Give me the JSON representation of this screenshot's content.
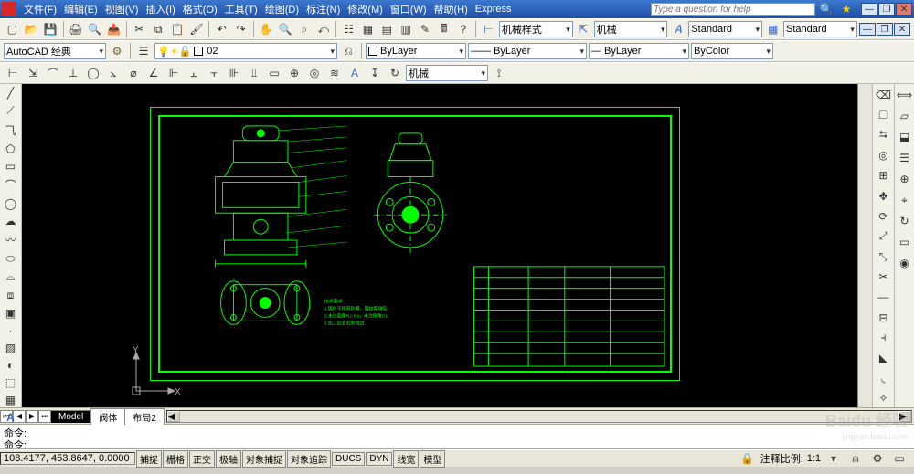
{
  "menu": {
    "file": "文件(F)",
    "edit": "编辑(E)",
    "view": "视图(V)",
    "insert": "插入(I)",
    "format": "格式(O)",
    "tools": "工具(T)",
    "draw": "绘图(D)",
    "dim": "标注(N)",
    "modify": "修改(M)",
    "window": "窗口(W)",
    "help": "帮助(H)",
    "express": "Express"
  },
  "help_placeholder": "Type a question for help",
  "workspace_combo": "AutoCAD 经典",
  "layer_combo": "02",
  "dimstyle1": "机械样式",
  "dimstyle2": "机械",
  "bylayer": "ByLayer",
  "bycolor": "ByColor",
  "standard": "Standard",
  "mech": "机械",
  "ucs": {
    "x": "X",
    "y": "Y"
  },
  "tabs": {
    "model": "Model",
    "layout1": "阀体",
    "layout2": "布局2"
  },
  "cmd_label": "命令:",
  "status": {
    "coords": "108.4177, 453.8647, 0.0000",
    "snap": "捕捉",
    "grid": "栅格",
    "ortho": "正交",
    "polar": "极轴",
    "osnap": "对象捕捉",
    "otrack": "对象追踪",
    "ducs": "DUCS",
    "dyn": "DYN",
    "lwt": "线宽",
    "model": "模型",
    "annoscale": "注释比例:",
    "scale": "1:1"
  },
  "watermark": {
    "main": "Baidu 经验",
    "sub": "jingyan.baidu.com"
  }
}
